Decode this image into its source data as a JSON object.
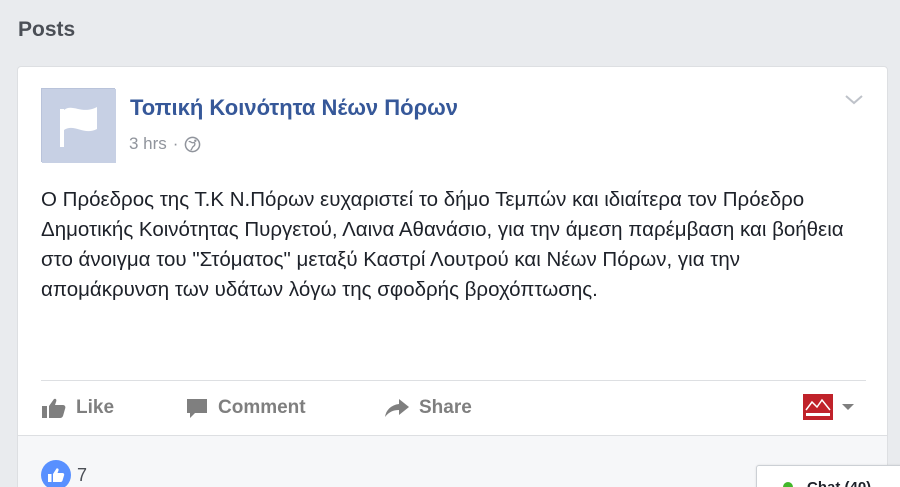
{
  "section": {
    "title": "Posts"
  },
  "post": {
    "page_name": "Τοπική Κοινότητα Νέων Πόρων",
    "time": "3 hrs",
    "separator": "·",
    "privacy_icon": "globe-icon",
    "body": "Ο Πρόεδρος της Τ.Κ Ν.Πόρων ευχαριστεί το δήμο Τεμπών και ιδιαίτερα τον Πρόεδρο Δημοτικής Κοινότητας Πυργετού, Λαινα Αθανάσιο, για την άμεση παρέμβαση και βοήθεια στο άνοιγμα του \"Στόματος\" μεταξύ Καστρί Λουτρού και Νέων Πόρων, για την απομάκρυνση των υδάτων λόγω της σφοδρής βροχόπτωσης."
  },
  "actions": {
    "like": "Like",
    "comment": "Comment",
    "share": "Share"
  },
  "reactions": {
    "like_count": "7"
  },
  "chat": {
    "label": "Chat (40)"
  },
  "colors": {
    "link": "#365899",
    "like_blue": "#5890ff",
    "action_gray": "#7f7f7f"
  }
}
